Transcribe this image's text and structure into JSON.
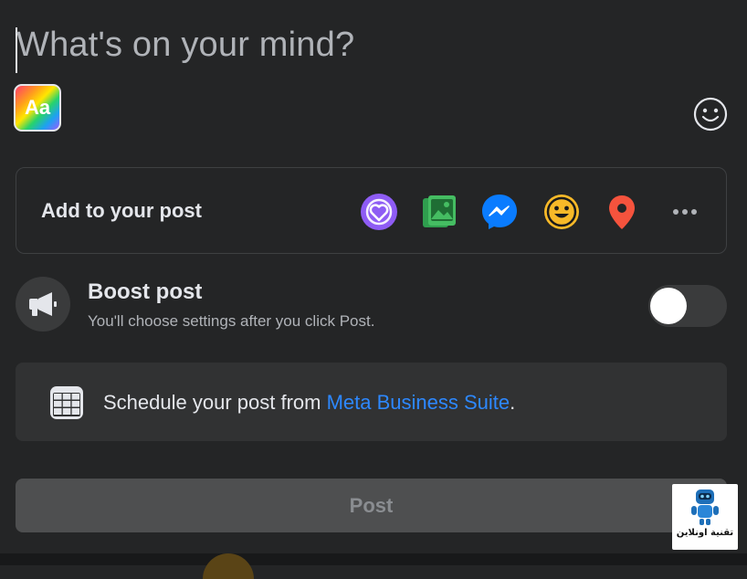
{
  "composer": {
    "placeholder": "What's on your mind?",
    "text_format_label": "Aa",
    "emoji_icon": "smiley-icon"
  },
  "add_to_post": {
    "label": "Add to your post",
    "icons": [
      {
        "name": "support-heart-icon",
        "color": "#8e5cf4"
      },
      {
        "name": "photo-video-icon",
        "color": "#45bd62"
      },
      {
        "name": "messenger-icon",
        "color": "#0a7cff"
      },
      {
        "name": "feeling-activity-icon",
        "color": "#f7b928"
      },
      {
        "name": "check-in-location-icon",
        "color": "#f5533d"
      },
      {
        "name": "more-options-icon",
        "color": "#b0b3b8"
      }
    ]
  },
  "boost": {
    "title": "Boost post",
    "subtitle": "You'll choose settings after you click Post.",
    "enabled": false
  },
  "schedule": {
    "text": "Schedule your post from ",
    "link": "Meta Business Suite",
    "suffix": "."
  },
  "post_button": {
    "label": "Post"
  },
  "watermark": {
    "text": "تقنية اونلاين"
  },
  "colors": {
    "background": "#242526",
    "link": "#2d88ff",
    "muted_text": "#b0b3b8"
  }
}
